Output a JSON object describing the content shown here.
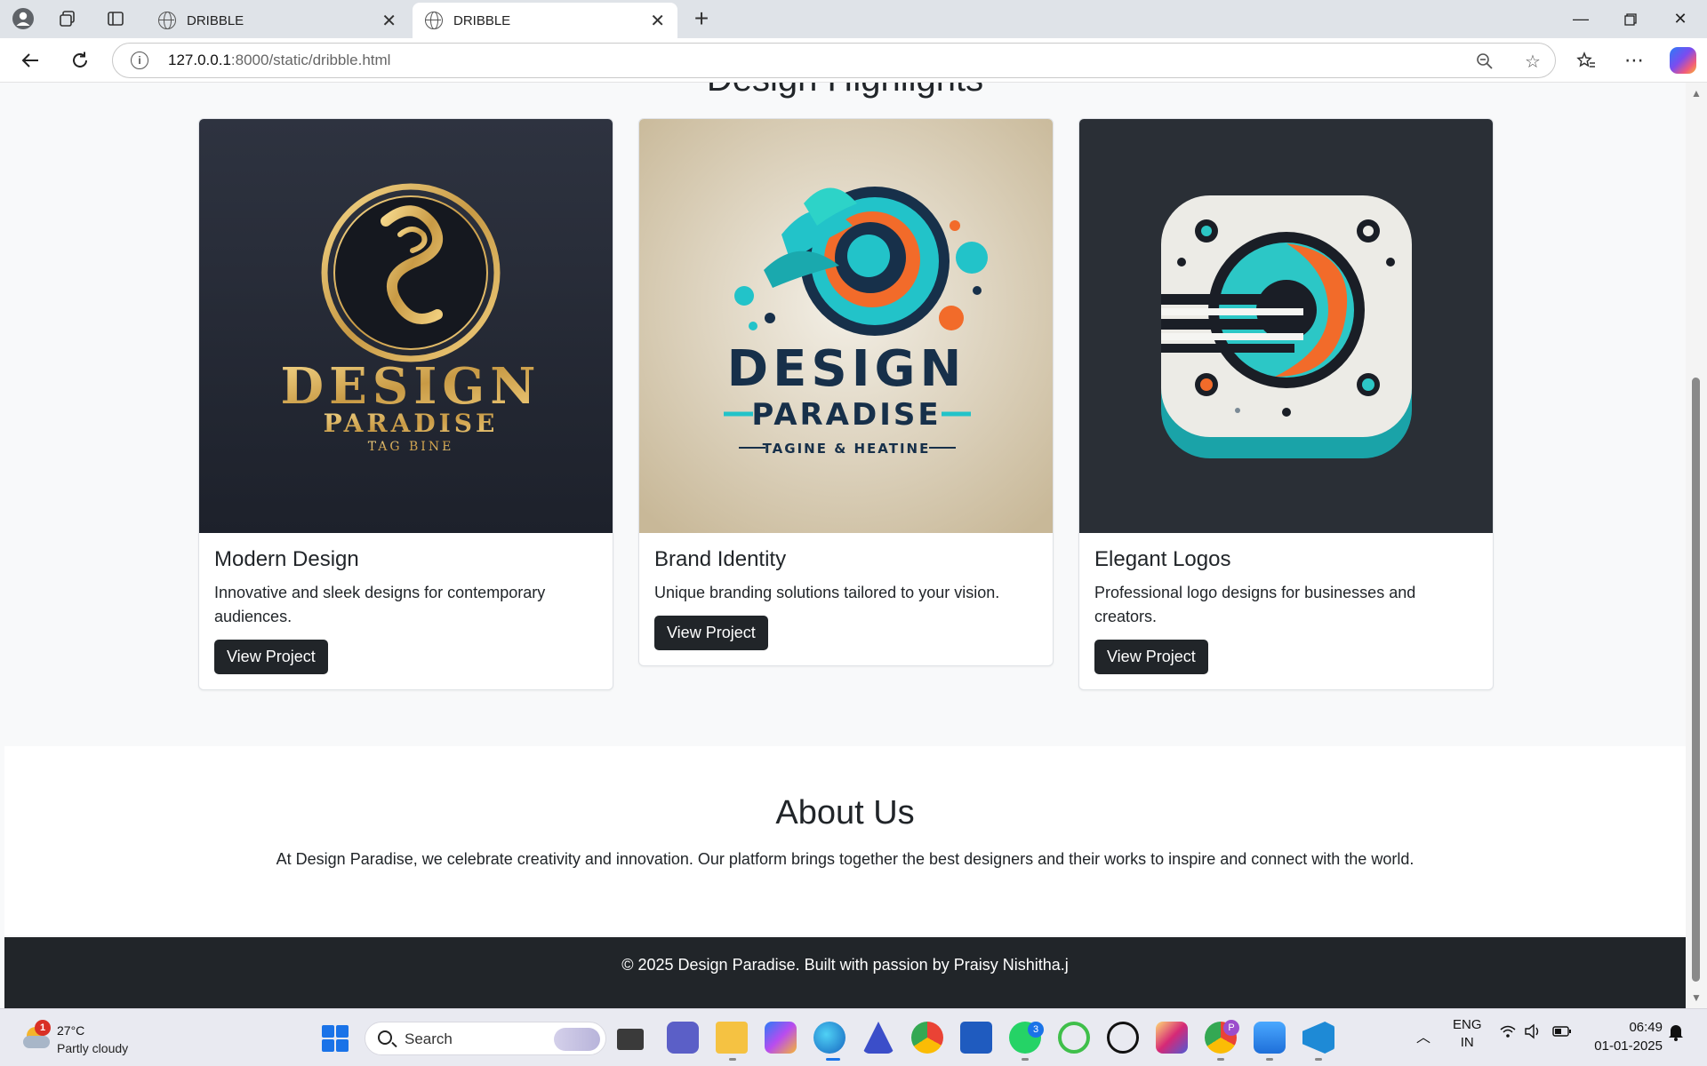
{
  "browser": {
    "tabs": [
      {
        "title": "DRIBBLE",
        "active": false
      },
      {
        "title": "DRIBBLE",
        "active": true
      }
    ],
    "url_host": "127.0.0.1",
    "url_path": ":8000/static/dribble.html"
  },
  "page": {
    "section_title": "Design Highlights",
    "cards": [
      {
        "title": "Modern Design",
        "text": "Innovative and sleek designs for contemporary audiences.",
        "button": "View Project",
        "logo": {
          "line1": "DESIGN",
          "line2": "PARADISE",
          "line3": "TAG BINE"
        }
      },
      {
        "title": "Brand Identity",
        "text": "Unique branding solutions tailored to your vision.",
        "button": "View Project",
        "logo": {
          "line1": "DESIGN",
          "line2": "PARADISE",
          "line3": "TAGINE & HEATINE"
        }
      },
      {
        "title": "Elegant Logos",
        "text": "Professional logo designs for businesses and creators.",
        "button": "View Project"
      }
    ],
    "about": {
      "title": "About Us",
      "text": "At Design Paradise, we celebrate creativity and innovation. Our platform brings together the best designers and their works to inspire and connect with the world."
    },
    "footer": "© 2025 Design Paradise. Built with passion by Praisy Nishitha.j"
  },
  "taskbar": {
    "weather": {
      "badge": "1",
      "temp": "27°C",
      "condition": "Partly cloudy"
    },
    "search_placeholder": "Search",
    "whatsapp_badge": "3",
    "profile_badge": "P",
    "lang_line1": "ENG",
    "lang_line2": "IN",
    "time": "06:49",
    "date": "01-01-2025"
  },
  "colors": {
    "dark": "#212529",
    "page_bg": "#f8f9fa",
    "gold": "#d8b15c",
    "teal": "#22c3c9",
    "orange": "#f26b2a",
    "navy": "#17304a"
  }
}
